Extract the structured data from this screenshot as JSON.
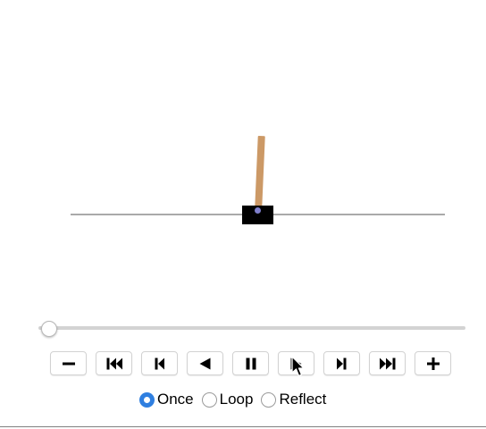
{
  "animation": {
    "frame_index": 0,
    "colors": {
      "track": "#a9a9a9",
      "pole": "#cc9966",
      "cart": "#000000",
      "axle": "#7f7fcc"
    }
  },
  "slider": {
    "value": 0,
    "min": 0,
    "max": 1
  },
  "controls": [
    {
      "name": "decrease-speed-button",
      "icon": "minus-icon"
    },
    {
      "name": "first-frame-button",
      "icon": "skip-to-start-icon"
    },
    {
      "name": "previous-frame-button",
      "icon": "step-back-icon"
    },
    {
      "name": "play-reverse-button",
      "icon": "play-reverse-icon"
    },
    {
      "name": "pause-button",
      "icon": "pause-icon"
    },
    {
      "name": "play-button",
      "icon": "play-icon"
    },
    {
      "name": "next-frame-button",
      "icon": "step-forward-icon"
    },
    {
      "name": "last-frame-button",
      "icon": "skip-to-end-icon"
    },
    {
      "name": "increase-speed-button",
      "icon": "plus-icon"
    }
  ],
  "loop_mode": {
    "selected": "Once",
    "options": [
      {
        "label": "Once",
        "checked": true
      },
      {
        "label": "Loop",
        "checked": false
      },
      {
        "label": "Reflect",
        "checked": false
      }
    ],
    "accent_color": "#2f7fe0"
  }
}
